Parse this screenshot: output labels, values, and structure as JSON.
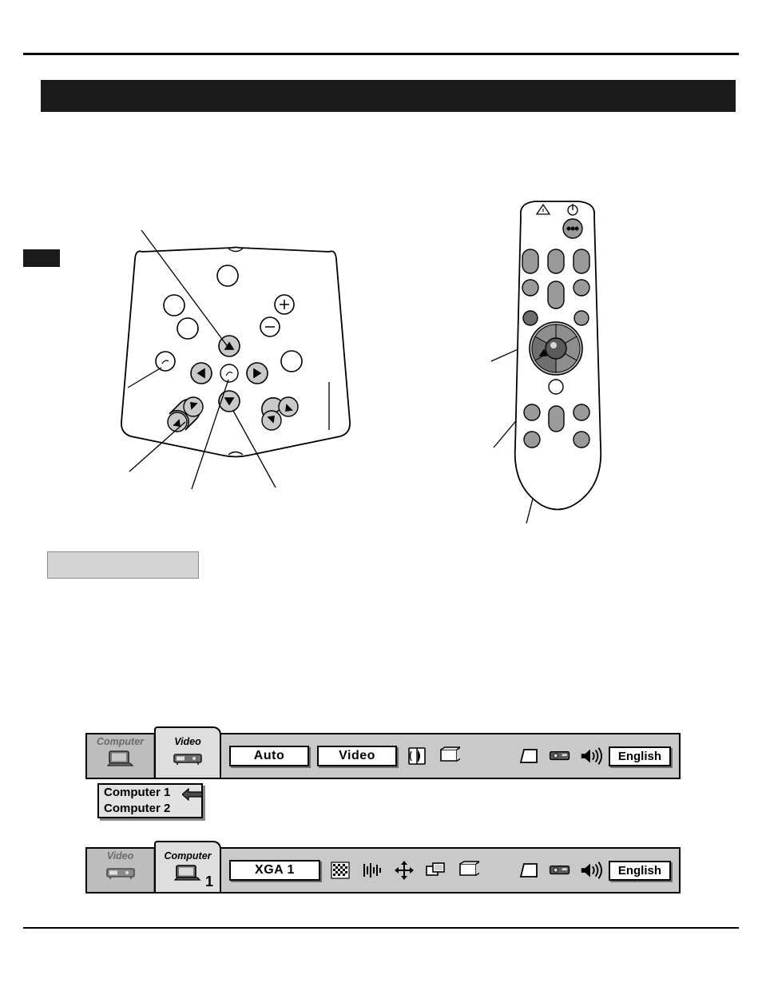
{
  "page": {
    "side_tab_label": "",
    "banner_title": "",
    "note_box_text": ""
  },
  "diagram": {
    "control_panel_name": "projector-control-panel",
    "remote_name": "remote-control-unit",
    "callouts": []
  },
  "menus": {
    "video_menu": {
      "tabs": [
        {
          "label": "Computer",
          "icon": "computer-monitor-icon",
          "state": "inactive"
        },
        {
          "label": "Video",
          "icon": "video-deck-icon",
          "state": "active"
        }
      ],
      "items": [
        {
          "label": "Auto",
          "type": "lcd"
        },
        {
          "label": "Video",
          "type": "lcd"
        },
        {
          "label": "",
          "type": "icon",
          "icon": "image-adjust-icon"
        },
        {
          "label": "",
          "type": "icon",
          "icon": "screen-icon"
        }
      ],
      "system_icons": [
        {
          "icon": "keystone-icon"
        },
        {
          "icon": "projector-icon"
        },
        {
          "icon": "volume-icon"
        }
      ],
      "language": "English"
    },
    "dropdown": {
      "items": [
        {
          "label": "Computer 1",
          "selected": true
        },
        {
          "label": "Computer 2",
          "selected": false
        }
      ],
      "pointer_icon": "left-arrow-icon"
    },
    "computer_menu": {
      "tabs": [
        {
          "label": "Video",
          "icon": "video-deck-icon",
          "state": "inactive"
        },
        {
          "label": "Computer",
          "icon": "computer-monitor-icon",
          "state": "active",
          "numeral": "1"
        }
      ],
      "items": [
        {
          "label": "XGA 1",
          "type": "lcd"
        },
        {
          "label": "",
          "type": "icon",
          "icon": "checkerboard-icon"
        },
        {
          "label": "",
          "type": "icon",
          "icon": "fine-sync-icon"
        },
        {
          "label": "",
          "type": "icon",
          "icon": "position-move-icon"
        },
        {
          "label": "",
          "type": "icon",
          "icon": "pc-adjust-icon"
        },
        {
          "label": "",
          "type": "icon",
          "icon": "screen-icon"
        }
      ],
      "system_icons": [
        {
          "icon": "keystone-icon"
        },
        {
          "icon": "projector-icon"
        },
        {
          "icon": "volume-icon"
        }
      ],
      "language": "English"
    }
  }
}
